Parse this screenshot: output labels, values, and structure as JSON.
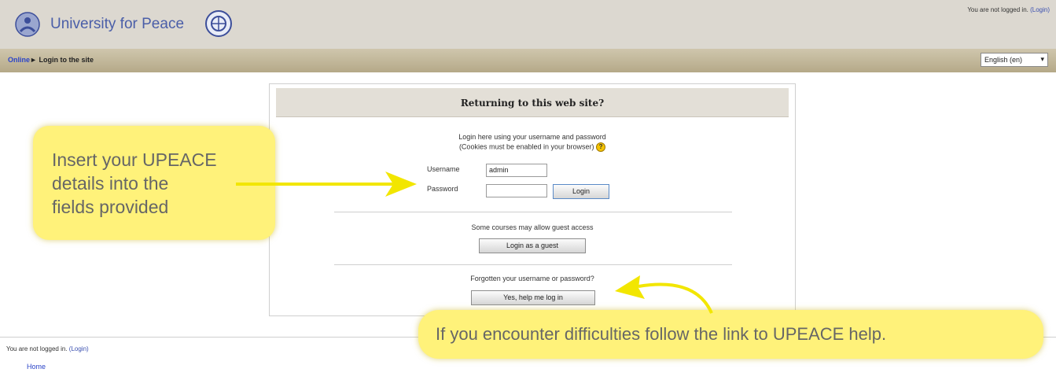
{
  "header": {
    "site_title": "University for Peace",
    "logo_left_icon": "upeace-logo-icon",
    "logo_right_icon": "un-emblem-icon",
    "login_status": "You are not logged in.",
    "login_link": "(Login)"
  },
  "navbar": {
    "breadcrumb_home": "Online",
    "breadcrumb_separator": "►",
    "breadcrumb_current": "Login to the site",
    "language_selected": "English (en)"
  },
  "login_box": {
    "title": "Returning to this web site?",
    "intro_line1": "Login here using your username and password",
    "intro_line2": "(Cookies must be enabled in your browser)",
    "help_icon": "help-icon",
    "username_label": "Username",
    "username_value": "admin",
    "password_label": "Password",
    "password_value": "",
    "login_button": "Login",
    "guest_text": "Some courses may allow guest access",
    "guest_button": "Login as a guest",
    "forgot_text": "Forgotten your username or password?",
    "help_button": "Yes, help me log in"
  },
  "callouts": {
    "fields_callout": "Insert your UPEACE\ndetails into the\nfields provided",
    "help_callout": "If you encounter difficulties follow the link to UPEACE help."
  },
  "footer": {
    "login_status": "You are not logged in.",
    "login_link": "(Login)",
    "home_link": "Home"
  },
  "colors": {
    "header_bg": "#dcd8d0",
    "navbar_bg": "#b5a988",
    "link": "#2b44c8",
    "callout_bg": "#fff27a",
    "arrow": "#f2e600"
  }
}
